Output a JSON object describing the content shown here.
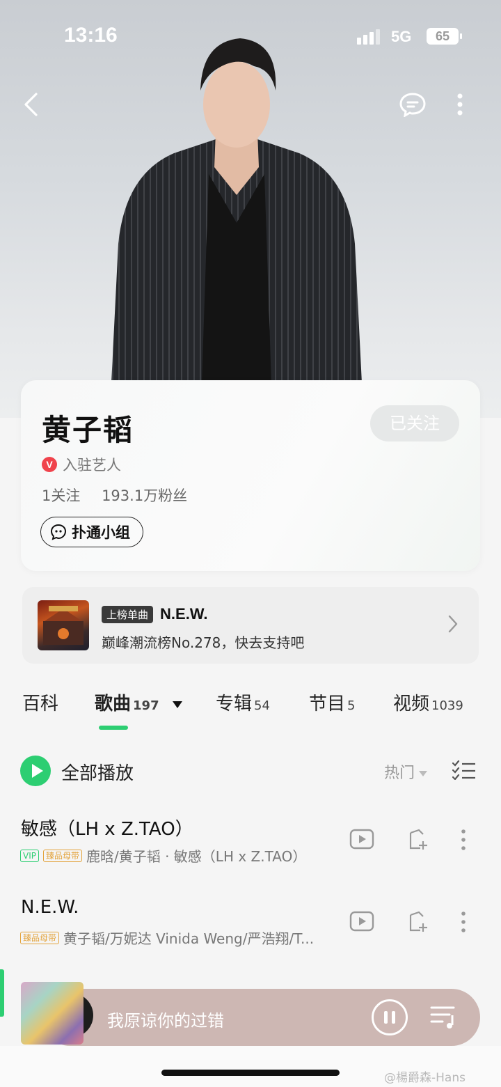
{
  "status_bar": {
    "time": "13:16",
    "network": "5G",
    "battery": "65"
  },
  "artist": {
    "name": "黄子韬",
    "follow_label": "已关注",
    "verified_badge": "V",
    "verified_label": "入驻艺人",
    "following": "1关注",
    "fans": "193.1万粉丝",
    "group_label": "扑通小组"
  },
  "chart_banner": {
    "tag": "上榜单曲",
    "song": "N.E.W.",
    "subtitle": "巅峰潮流榜No.278，快去支持吧"
  },
  "tabs": [
    {
      "label": "百科",
      "count": ""
    },
    {
      "label": "歌曲",
      "count": "197"
    },
    {
      "label": "专辑",
      "count": "54"
    },
    {
      "label": "节目",
      "count": "5"
    },
    {
      "label": "视频",
      "count": "1039"
    }
  ],
  "song_list": {
    "play_all_label": "全部播放",
    "sort_label": "热门",
    "songs": [
      {
        "title": "敏感（LH x Z.TAO）",
        "tags": [
          "VIP",
          "臻品母带"
        ],
        "meta": "鹿晗/黄子韬 · 敏感（LH x Z.TAO）"
      },
      {
        "title": "N.E.W.",
        "tags": [
          "臻品母带"
        ],
        "meta": "黄子韬/万妮达 Vinida Weng/严浩翔/T..."
      }
    ]
  },
  "player": {
    "now_playing": "我原谅你的过错"
  },
  "watermark": "@楊爵森-Hans",
  "colors": {
    "accent": "#2dce72",
    "player_bg": "#cdb7b3",
    "verified": "#f0434c"
  }
}
